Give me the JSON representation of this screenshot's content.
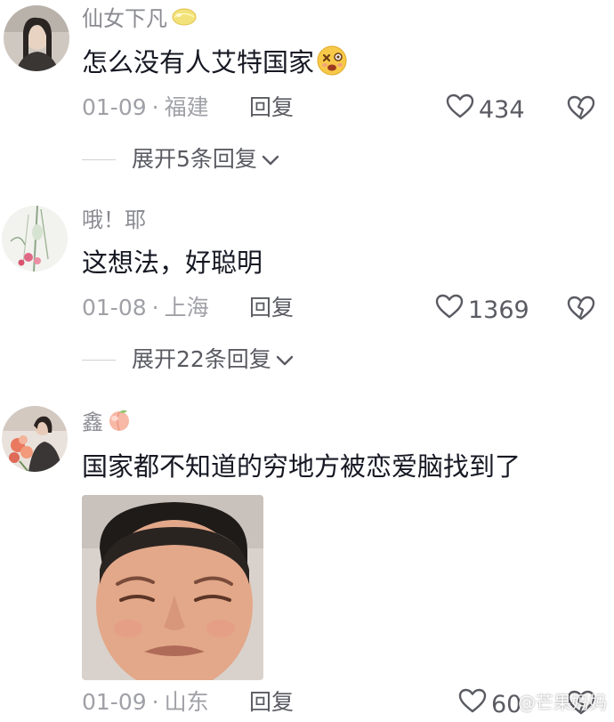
{
  "comments": [
    {
      "username": "仙女下凡",
      "badge_icon": "lemon-icon",
      "text": "怎么没有人艾特国家",
      "text_emoji": "dizzy-face-emoji",
      "date": "01-09",
      "separator": "·",
      "location": "福建",
      "reply_label": "回复",
      "likes": "434",
      "expand_label": "展开5条回复"
    },
    {
      "username": "哦！耶",
      "text": "这想法，好聪明",
      "date": "01-08",
      "separator": "·",
      "location": "上海",
      "reply_label": "回复",
      "likes": "1369",
      "expand_label": "展开22条回复"
    },
    {
      "username": "鑫",
      "badge_icon": "peach-icon",
      "text": "国家都不知道的穷地方被恋爱脑找到了",
      "has_sticker": true,
      "date": "01-09",
      "separator": "·",
      "location": "山东",
      "reply_label": "回复",
      "likes": "60"
    }
  ],
  "watermark": "@芒果妈妈",
  "colors": {
    "text_primary": "#161823",
    "text_secondary": "#8a8b91",
    "text_meta": "#a0a1a7",
    "action": "#5a5b62"
  }
}
